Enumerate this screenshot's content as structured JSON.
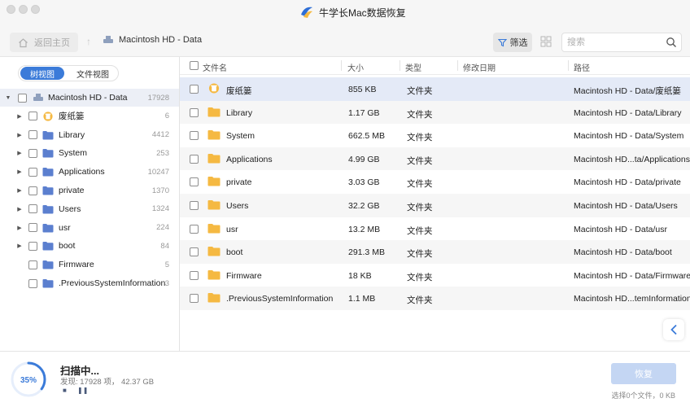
{
  "window": {
    "title": "牛学长Mac数据恢复"
  },
  "toolbar": {
    "home_label": "返回主页",
    "breadcrumb": "Macintosh HD - Data",
    "filter_label": "筛选",
    "search_placeholder": "搜索"
  },
  "sidebar": {
    "tabs": [
      {
        "label": "树视图",
        "active": true
      },
      {
        "label": "文件视图",
        "active": false
      }
    ],
    "root": {
      "label": "Macintosh HD - Data",
      "count": "17928"
    },
    "items": [
      {
        "label": "废纸篓",
        "count": "6",
        "icon": "trash-icon",
        "expandable": true
      },
      {
        "label": "Library",
        "count": "4412",
        "icon": "folder-icon",
        "expandable": true
      },
      {
        "label": "System",
        "count": "253",
        "icon": "folder-icon",
        "expandable": true
      },
      {
        "label": "Applications",
        "count": "10247",
        "icon": "folder-icon",
        "expandable": true
      },
      {
        "label": "private",
        "count": "1370",
        "icon": "folder-icon",
        "expandable": true
      },
      {
        "label": "Users",
        "count": "1324",
        "icon": "folder-icon",
        "expandable": true
      },
      {
        "label": "usr",
        "count": "224",
        "icon": "folder-icon",
        "expandable": true
      },
      {
        "label": "boot",
        "count": "84",
        "icon": "folder-icon",
        "expandable": true
      },
      {
        "label": "Firmware",
        "count": "5",
        "icon": "folder-icon",
        "expandable": false
      },
      {
        "label": ".PreviousSystemInformation",
        "count": "3",
        "icon": "folder-icon",
        "expandable": false
      }
    ]
  },
  "list": {
    "columns": {
      "name": "文件名",
      "size": "大小",
      "type": "类型",
      "modified": "修改日期",
      "path": "路径"
    },
    "rows": [
      {
        "name": "废纸篓",
        "size": "855 KB",
        "type": "文件夹",
        "modified": "",
        "path": "Macintosh HD - Data/废纸篓",
        "icon": "trash-icon"
      },
      {
        "name": "Library",
        "size": "1.17 GB",
        "type": "文件夹",
        "modified": "",
        "path": "Macintosh HD - Data/Library",
        "icon": "folder-icon"
      },
      {
        "name": "System",
        "size": "662.5 MB",
        "type": "文件夹",
        "modified": "",
        "path": "Macintosh HD - Data/System",
        "icon": "folder-icon"
      },
      {
        "name": "Applications",
        "size": "4.99 GB",
        "type": "文件夹",
        "modified": "",
        "path": "Macintosh HD...ta/Applications",
        "icon": "folder-icon"
      },
      {
        "name": "private",
        "size": "3.03 GB",
        "type": "文件夹",
        "modified": "",
        "path": "Macintosh HD - Data/private",
        "icon": "folder-icon"
      },
      {
        "name": "Users",
        "size": "32.2 GB",
        "type": "文件夹",
        "modified": "",
        "path": "Macintosh HD - Data/Users",
        "icon": "folder-icon"
      },
      {
        "name": "usr",
        "size": "13.2 MB",
        "type": "文件夹",
        "modified": "",
        "path": "Macintosh HD - Data/usr",
        "icon": "folder-icon"
      },
      {
        "name": "boot",
        "size": "291.3 MB",
        "type": "文件夹",
        "modified": "",
        "path": "Macintosh HD - Data/boot",
        "icon": "folder-icon"
      },
      {
        "name": "Firmware",
        "size": "18 KB",
        "type": "文件夹",
        "modified": "",
        "path": "Macintosh HD - Data/Firmware",
        "icon": "folder-icon"
      },
      {
        "name": ".PreviousSystemInformation",
        "size": "1.1 MB",
        "type": "文件夹",
        "modified": "",
        "path": "Macintosh HD...temInformation",
        "icon": "folder-icon"
      }
    ]
  },
  "scan": {
    "progress_label": "35%",
    "progress": 0.35,
    "title": "扫描中...",
    "detail": "发现: 17928 项， 42.37 GB"
  },
  "footer": {
    "recover_label": "恢复",
    "selection_status": "选择0个文件，0 KB"
  },
  "colors": {
    "accent": "#3b7bd9",
    "folder": "#f5b942",
    "selected_row": "#e4eaf7",
    "recover_disabled": "#c4d6f3"
  }
}
